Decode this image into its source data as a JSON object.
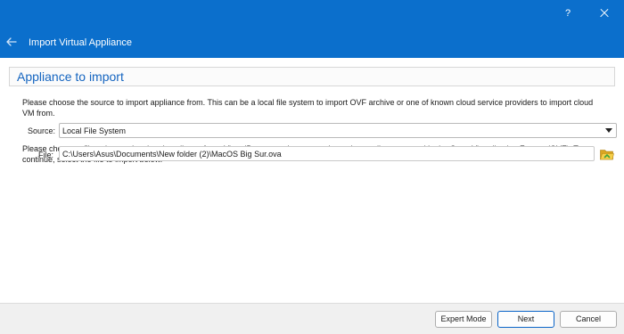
{
  "titlebar": {
    "help_label": "?",
    "title": "Import Virtual Appliance",
    "color": "#0b6fcc"
  },
  "icons": {
    "back": "back-arrow-icon",
    "close": "close-icon",
    "folder": "folder-open-icon"
  },
  "page": {
    "heading": "Appliance to import",
    "source_intro": "Please choose the source to import appliance from. This can be a local file system to import OVF archive or one of known cloud service providers to import cloud VM from.",
    "source_label": "Source:",
    "source_value": "Local File System",
    "file_intro": "Please choose a file to import the virtual appliance from. VirtualBox currently supports importing appliances saved in the Open Virtualization Format (OVF). To continue, select the file to import below.",
    "file_label": "File:",
    "file_value": "C:\\Users\\Asus\\Documents\\New folder (2)\\MacOS Big Sur.ova"
  },
  "footer": {
    "expert_mode": "Expert Mode",
    "next": "Next",
    "cancel": "Cancel"
  }
}
